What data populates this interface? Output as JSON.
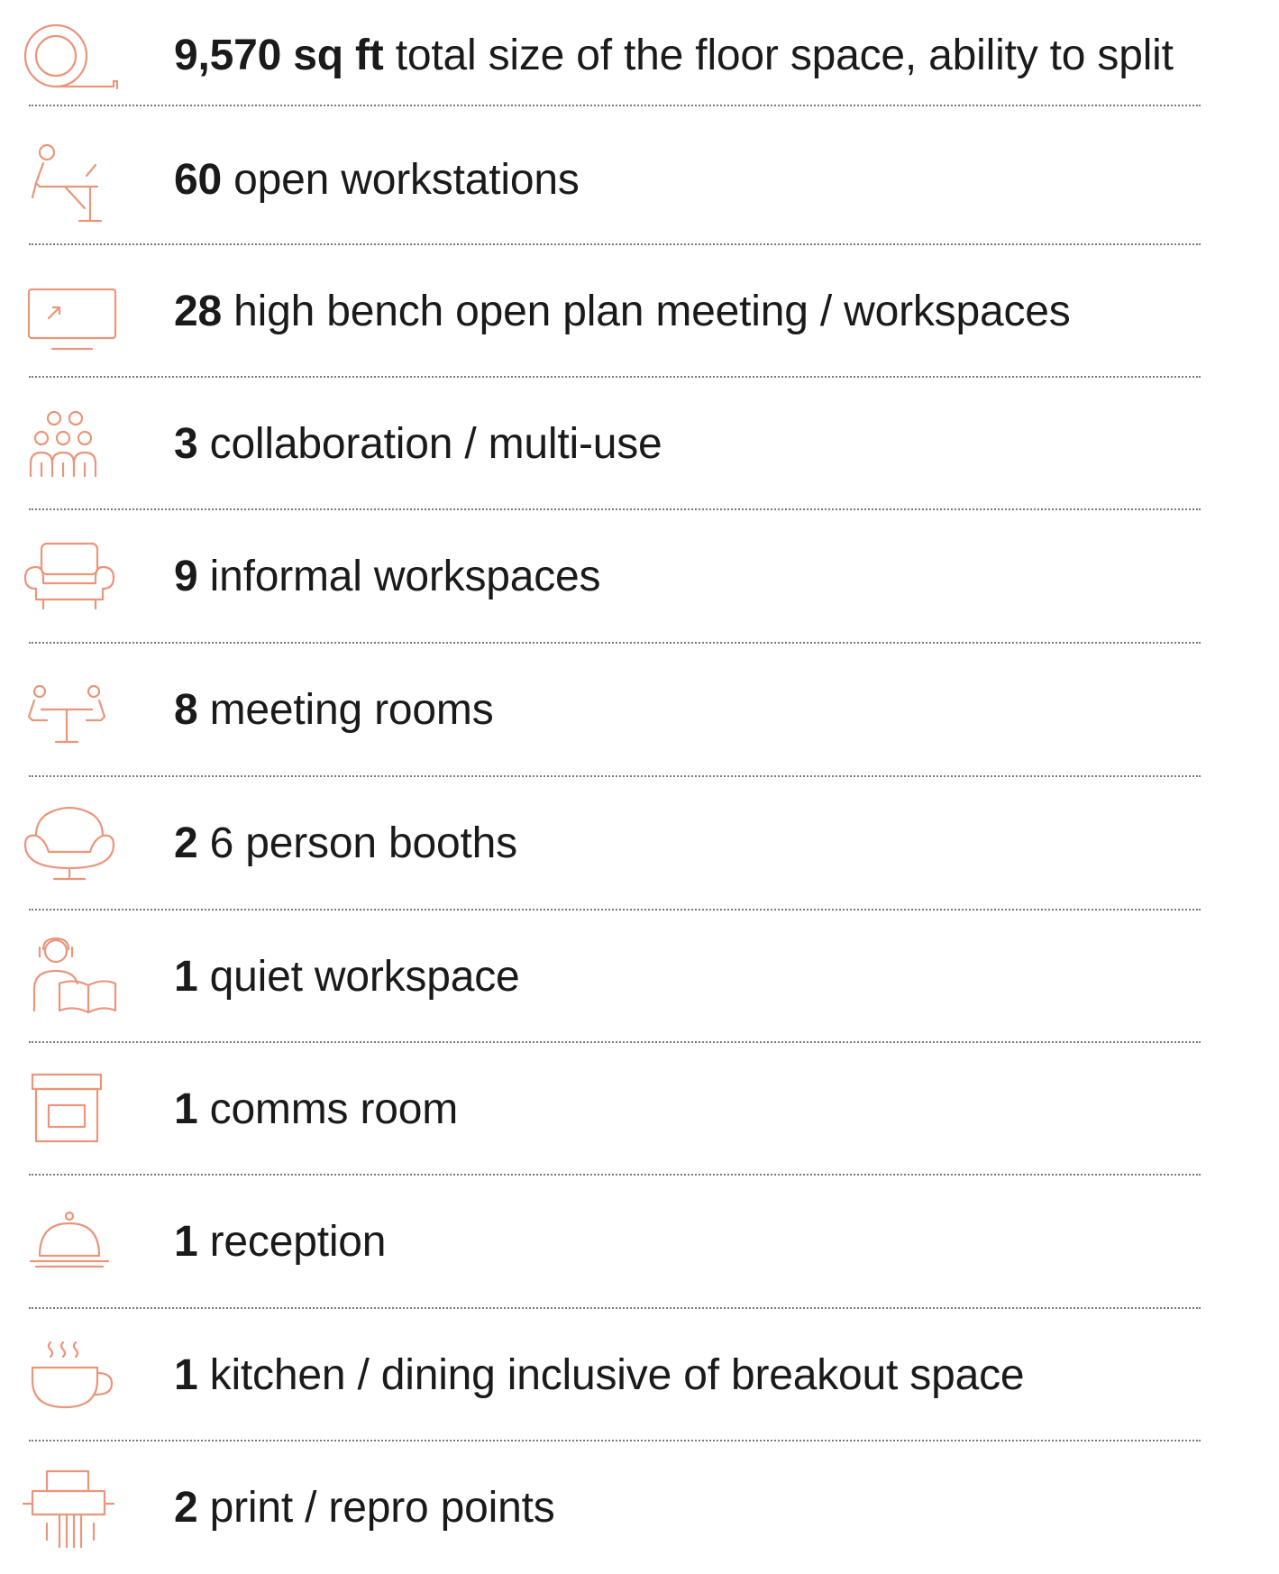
{
  "accent_color": "#e9967a",
  "items": [
    {
      "icon": "tape-measure-icon",
      "count": "9,570 sq ft",
      "text": "total size of the floor space, ability to split"
    },
    {
      "icon": "person-at-desk-icon",
      "count": "60",
      "text": "open workstations"
    },
    {
      "icon": "monitor-icon",
      "count": "28",
      "text": "high bench open plan meeting / workspaces"
    },
    {
      "icon": "group-of-people-icon",
      "count": "3",
      "text": "collaboration / multi-use"
    },
    {
      "icon": "armchair-icon",
      "count": "9",
      "text": "informal workspaces"
    },
    {
      "icon": "meeting-table-icon",
      "count": "8",
      "text": "meeting rooms"
    },
    {
      "icon": "lounge-chair-icon",
      "count": "2",
      "text": "6 person booths"
    },
    {
      "icon": "person-reading-icon",
      "count": "1",
      "text": "quiet workspace"
    },
    {
      "icon": "server-cabinet-icon",
      "count": "1",
      "text": "comms room"
    },
    {
      "icon": "reception-bell-icon",
      "count": "1",
      "text": "reception"
    },
    {
      "icon": "coffee-cup-icon",
      "count": "1",
      "text": "kitchen / dining inclusive of breakout space"
    },
    {
      "icon": "printer-icon",
      "count": "2",
      "text": "print / repro points"
    }
  ]
}
